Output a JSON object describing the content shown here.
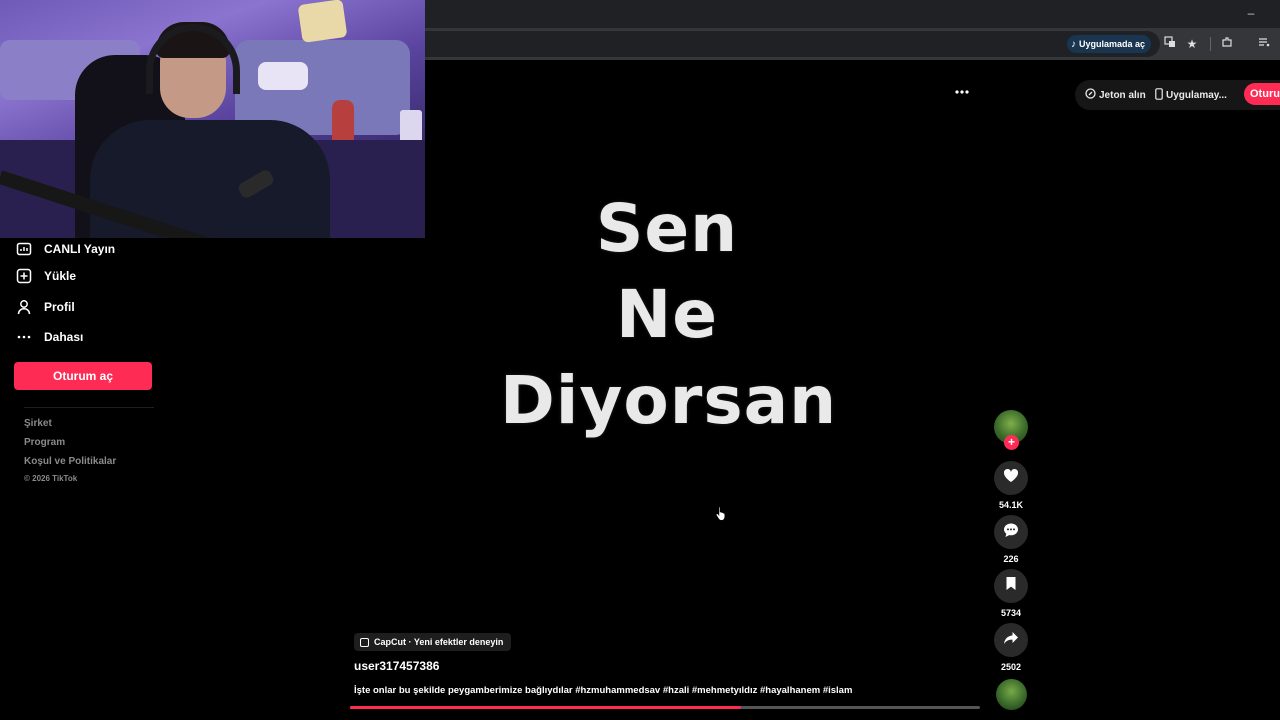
{
  "browser": {
    "open_in_app_label": "Uygulamada aç",
    "minimize_glyph": "–"
  },
  "sidebar": {
    "items": [
      {
        "label": "CANLI Yayın",
        "icon": "live-icon"
      },
      {
        "label": "Yükle",
        "icon": "upload-icon"
      },
      {
        "label": "Profil",
        "icon": "profile-icon"
      },
      {
        "label": "Dahası",
        "icon": "more-icon"
      }
    ],
    "login_button": "Oturum aç",
    "footer_links": [
      "Şirket",
      "Program",
      "Koşul ve Politikalar"
    ],
    "copyright": "© 2026 TikTok"
  },
  "top_actions": {
    "coins_label": "Jeton alın",
    "app_label": "Uygulamay...",
    "login_label": "Oturum aç"
  },
  "video": {
    "overlay_lines": [
      "Sen",
      "Ne",
      "Diyorsan"
    ],
    "effect_label": "CapCut · Yeni efektler deneyin",
    "username": "user317457386",
    "caption": "İşte onlar bu şekilde peygamberimize bağlıydılar #hzmuhammedsav #hzali #mehmetyıldız #hayalhanem #islam",
    "progress": 0.62
  },
  "actions": {
    "likes": "54.1K",
    "comments": "226",
    "saves": "5734",
    "shares": "2502"
  },
  "colors": {
    "accent": "#fe2c55",
    "background": "#000000"
  }
}
